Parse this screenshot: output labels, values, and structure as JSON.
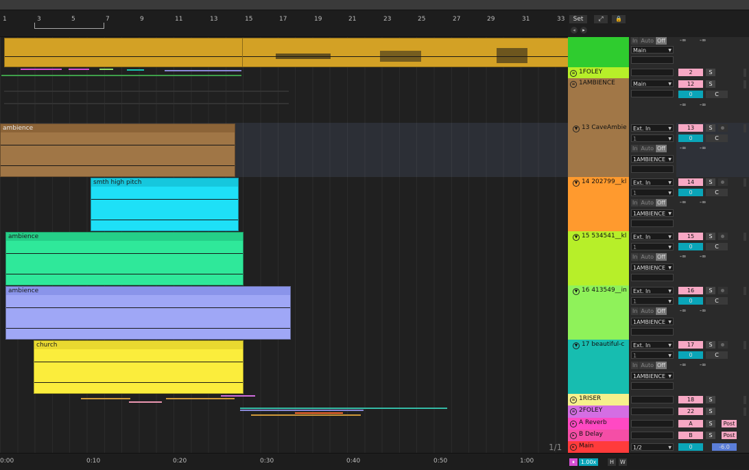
{
  "ruler": {
    "bars": [
      "1",
      "3",
      "5",
      "7",
      "9",
      "11",
      "13",
      "15",
      "17",
      "19",
      "21",
      "23",
      "25",
      "27",
      "29",
      "31",
      "33"
    ],
    "set_label": "Set"
  },
  "clips": {
    "ambience_brown": "ambience",
    "smth_high_pitch": "smth high pitch",
    "ambience_green": "ambience",
    "ambience_blue": "ambience",
    "church": "church"
  },
  "tracks": [
    {
      "name": "",
      "color": "#2fcc2f"
    },
    {
      "name": "1FOLEY",
      "color": "#b7ef29",
      "number": "2",
      "solo": "S"
    },
    {
      "name": "1AMBIENCE",
      "color": "#a17747",
      "number": "12",
      "solo": "S",
      "route": "Main",
      "pan": "0",
      "c": "C",
      "vol": "-∞",
      "vol2": "-∞"
    },
    {
      "name": "13 CaveAmbie",
      "color": "#a17747",
      "number": "13",
      "solo": "S",
      "input": "Ext. In",
      "ch": "1",
      "out": "1AMBIENCE",
      "pan": "0",
      "c": "C",
      "vol": "-∞",
      "vol2": "-∞"
    },
    {
      "name": "14 202799__kl",
      "color": "#ff9a2e",
      "number": "14",
      "solo": "S",
      "input": "Ext. In",
      "ch": "1",
      "out": "1AMBIENCE",
      "pan": "0",
      "c": "C",
      "vol": "-∞",
      "vol2": "-∞"
    },
    {
      "name": "15 534541__kl",
      "color": "#b7ef29",
      "number": "15",
      "solo": "S",
      "input": "Ext. In",
      "ch": "1",
      "out": "1AMBIENCE",
      "pan": "0",
      "c": "C",
      "vol": "-∞",
      "vol2": "-∞"
    },
    {
      "name": "16 413549__in",
      "color": "#8ff25a",
      "number": "16",
      "solo": "S",
      "input": "Ext. In",
      "ch": "1",
      "out": "1AMBIENCE",
      "pan": "0",
      "c": "C",
      "vol": "-∞",
      "vol2": "-∞"
    },
    {
      "name": "17 beautiful-c",
      "color": "#17bdb0",
      "number": "17",
      "solo": "S",
      "input": "Ext. In",
      "ch": "1",
      "out": "1AMBIENCE",
      "pan": "0",
      "c": "C",
      "vol": "-∞",
      "vol2": "-∞"
    },
    {
      "name": "1RISER",
      "color": "#f6f08b",
      "number": "18",
      "solo": "S"
    },
    {
      "name": "2FOLEY",
      "color": "#d46ee3",
      "number": "22",
      "solo": "S"
    },
    {
      "name": "A Reverb",
      "color": "#ff49c3",
      "number": "A",
      "solo": "S",
      "post": "Post"
    },
    {
      "name": "B Delay",
      "color": "#f54ea6",
      "number": "B",
      "solo": "S",
      "post": "Post"
    },
    {
      "name": "Main",
      "color": "#ff3b3b",
      "pan": "0",
      "vol": "-6.0",
      "route": "1/2"
    }
  ],
  "top_track": {
    "monitor": [
      "In",
      "Auto",
      "Off"
    ],
    "route": "Main",
    "vol": "-∞",
    "vol2": "-∞"
  },
  "monitor": [
    "In",
    "Auto",
    "Off"
  ],
  "page_indicator": "1/1",
  "time_ruler": [
    "0:00",
    "0:10",
    "0:20",
    "0:30",
    "0:40",
    "0:50",
    "1:00"
  ],
  "bottom_right": {
    "zoom": "1.00x",
    "h": "H",
    "w": "W"
  }
}
